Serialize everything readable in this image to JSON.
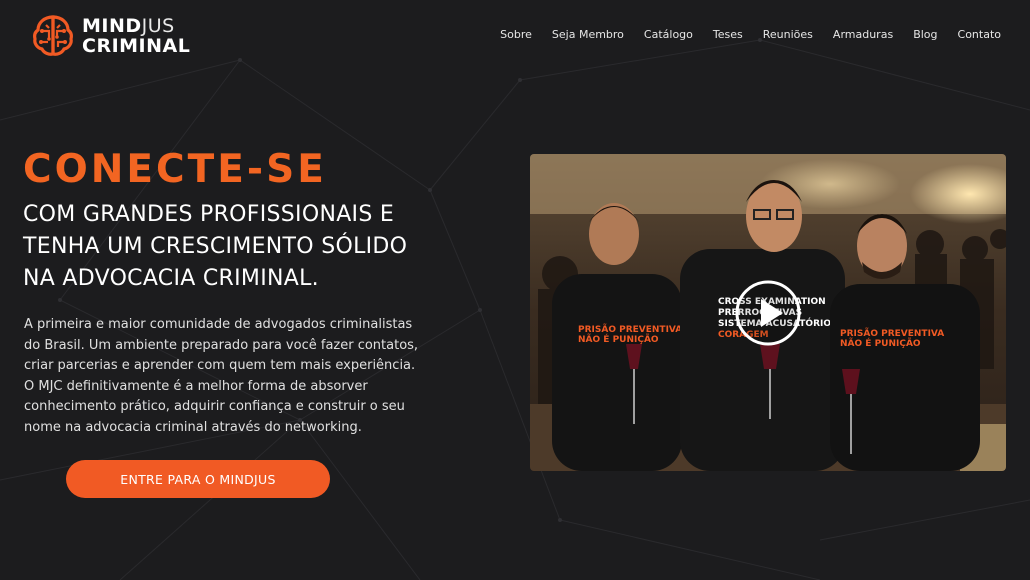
{
  "brand": {
    "line1_bold": "MIND",
    "line1_light": "JUS",
    "line2": "CRIMINAL",
    "logo_icon": "brain-circuit-icon",
    "accent_color": "#f15a24"
  },
  "nav": {
    "items": [
      "Sobre",
      "Seja Membro",
      "Catálogo",
      "Teses",
      "Reuniões",
      "Armaduras",
      "Blog",
      "Contato"
    ]
  },
  "hero": {
    "headline": "CONECTE-SE",
    "subhead_lines": [
      "COM GRANDES PROFISSIONAIS E",
      "TENHA UM CRESCIMENTO SÓLIDO",
      "NA ADVOCACIA CRIMINAL."
    ],
    "paragraph": "A primeira e maior comunidade de advogados criminalistas do Brasil. Um ambiente preparado para você fazer contatos, criar parcerias e aprender com quem tem mais experiência. O MJC definitivamente é a melhor forma de absorver conhecimento prático, adquirir confiança e construir o seu nome na advocacia criminal através do networking.",
    "cta_label": "ENTRE PARA O MINDJUS"
  },
  "video": {
    "play_icon": "play-icon",
    "shirt_texts": {
      "left_line1": "PRISÃO PREVENTIVA",
      "left_line2": "NÃO É PUNIÇÃO",
      "center_line1": "CROSS EXAMINATION",
      "center_line2": "PRERROGATIVAS",
      "center_line3": "SISTEMA ACUSATÓRIO",
      "center_line4": "CORAGEM",
      "right_line1": "PRISÃO PREVENTIVA",
      "right_line2": "NÃO É PUNIÇÃO"
    }
  }
}
